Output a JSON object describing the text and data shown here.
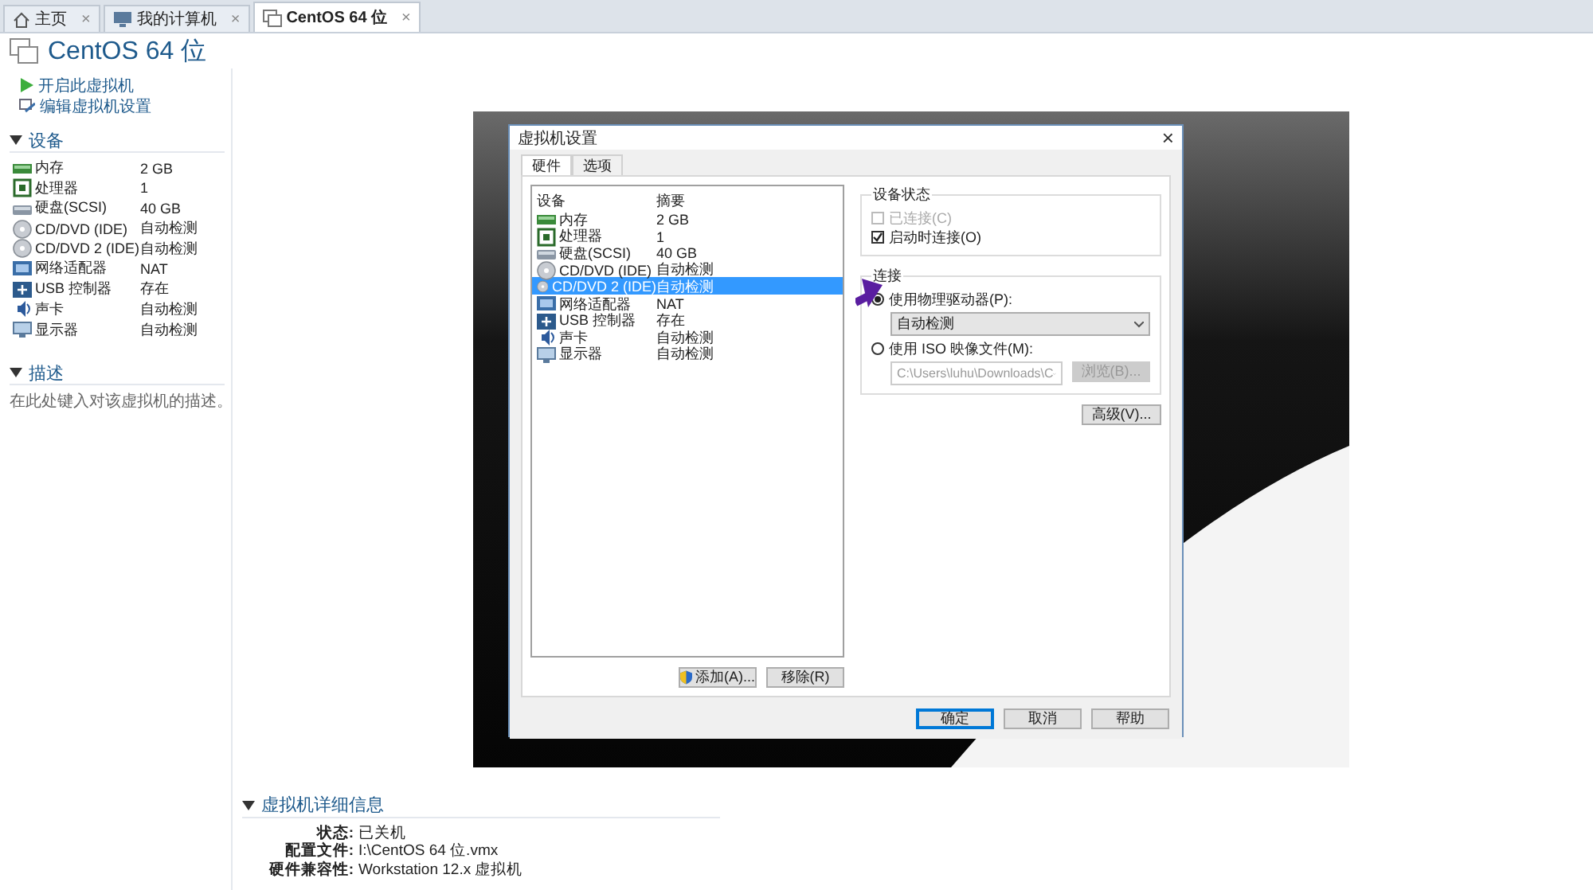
{
  "tabs": [
    {
      "label": "主页",
      "kind": "home",
      "selected": false,
      "close": "×"
    },
    {
      "label": "我的计算机",
      "kind": "computer",
      "selected": false,
      "close": "×"
    },
    {
      "label": "CentOS 64 位",
      "kind": "vm",
      "selected": true,
      "close": "×"
    }
  ],
  "title": "CentOS 64 位",
  "actions": [
    {
      "label": "开启此虚拟机",
      "kind": "play"
    },
    {
      "label": "编辑虚拟机设置",
      "kind": "edit"
    }
  ],
  "devices_section": {
    "title": "设备",
    "expanded": true,
    "items": [
      {
        "name": "内存",
        "value": "2 GB",
        "kind": "memory"
      },
      {
        "name": "处理器",
        "value": "1",
        "kind": "cpu"
      },
      {
        "name": "硬盘(SCSI)",
        "value": "40 GB",
        "kind": "disk"
      },
      {
        "name": "CD/DVD (IDE)",
        "value": "自动检测",
        "kind": "cd"
      },
      {
        "name": "CD/DVD 2 (IDE)",
        "value": "自动检测",
        "kind": "cd"
      },
      {
        "name": "网络适配器",
        "value": "NAT",
        "kind": "network"
      },
      {
        "name": "USB 控制器",
        "value": "存在",
        "kind": "usb"
      },
      {
        "name": "声卡",
        "value": "自动检测",
        "kind": "sound"
      },
      {
        "name": "显示器",
        "value": "自动检测",
        "kind": "display"
      }
    ]
  },
  "description_section": {
    "title": "描述",
    "expanded": true,
    "placeholder": "在此处键入对该虚拟机的描述。"
  },
  "details_section": {
    "title": "虚拟机详细信息",
    "expanded": true,
    "rows": [
      {
        "label": "状态:",
        "value": "已关机"
      },
      {
        "label": "配置文件:",
        "value": "I:\\CentOS 64 位.vmx"
      },
      {
        "label": "硬件兼容性:",
        "value": "Workstation 12.x 虚拟机"
      }
    ]
  },
  "dialog": {
    "title": "虚拟机设置",
    "close": "×",
    "tabs": [
      {
        "label": "硬件",
        "selected": true
      },
      {
        "label": "选项",
        "selected": false
      }
    ],
    "columns": [
      "设备",
      "摘要"
    ],
    "rows": [
      {
        "name": "内存",
        "value": "2 GB",
        "kind": "memory",
        "selected": false
      },
      {
        "name": "处理器",
        "value": "1",
        "kind": "cpu",
        "selected": false
      },
      {
        "name": "硬盘(SCSI)",
        "value": "40 GB",
        "kind": "disk",
        "selected": false
      },
      {
        "name": "CD/DVD (IDE)",
        "value": "自动检测",
        "kind": "cd",
        "selected": false
      },
      {
        "name": "CD/DVD 2 (IDE)",
        "value": "自动检测",
        "kind": "cd",
        "selected": true
      },
      {
        "name": "网络适配器",
        "value": "NAT",
        "kind": "network",
        "selected": false
      },
      {
        "name": "USB 控制器",
        "value": "存在",
        "kind": "usb",
        "selected": false
      },
      {
        "name": "声卡",
        "value": "自动检测",
        "kind": "sound",
        "selected": false
      },
      {
        "name": "显示器",
        "value": "自动检测",
        "kind": "display",
        "selected": false
      }
    ],
    "add_button": "添加(A)...",
    "remove_button": "移除(R)",
    "device_status": {
      "title": "设备状态",
      "options": [
        {
          "label": "已连接(C)",
          "checked": false,
          "disabled": true
        },
        {
          "label": "启动时连接(O)",
          "checked": true,
          "disabled": false
        }
      ]
    },
    "connection": {
      "title": "连接",
      "physical": {
        "label": "使用物理驱动器(P):",
        "selected": true,
        "value": "自动检测"
      },
      "iso": {
        "label": "使用 ISO 映像文件(M):",
        "selected": false,
        "value": "C:\\Users\\luhu\\Downloads\\C",
        "browse": "浏览(B)...",
        "disabled": true
      }
    },
    "advanced_button": "高级(V)...",
    "buttons": [
      {
        "label": "确定",
        "selected": true
      },
      {
        "label": "取消",
        "selected": false
      },
      {
        "label": "帮助",
        "selected": false
      }
    ]
  }
}
